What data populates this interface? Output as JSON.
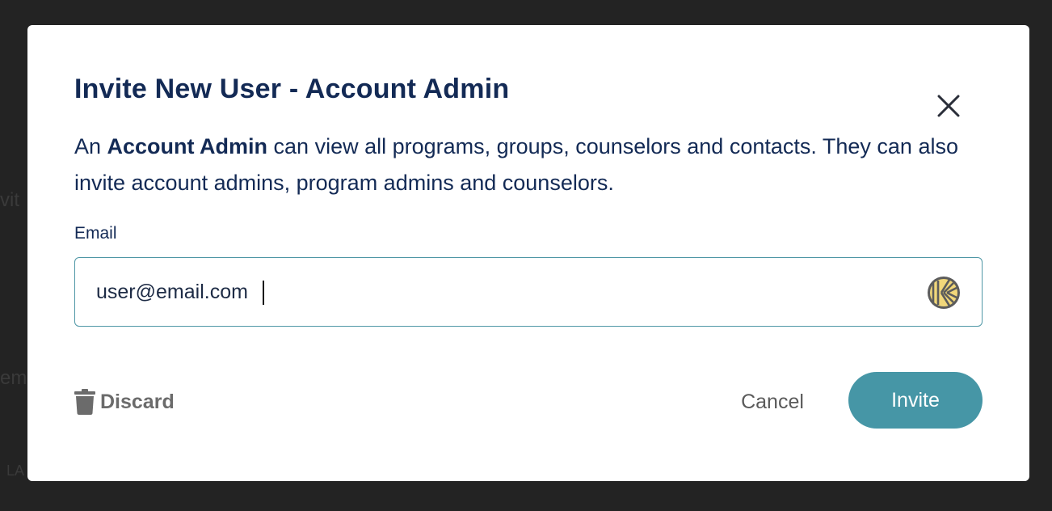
{
  "background": {
    "fragments": [
      "vit",
      "eme",
      "LA"
    ]
  },
  "modal": {
    "title": "Invite New User - Account Admin",
    "description": {
      "prefix": "An ",
      "role": "Account Admin",
      "suffix": " can view all programs, groups, counselors and contacts. They can also invite account admins, program admins and counselors."
    },
    "email": {
      "label": "Email",
      "value": "user@email.com"
    },
    "actions": {
      "discard_label": "Discard",
      "cancel_label": "Cancel",
      "invite_label": "Invite"
    }
  },
  "colors": {
    "heading": "#132a55",
    "accent": "#4696a6",
    "field_border": "#4f97a6"
  },
  "icons": {
    "close": "close-icon",
    "password_manager": "keeper-icon",
    "discard": "trash-icon"
  }
}
